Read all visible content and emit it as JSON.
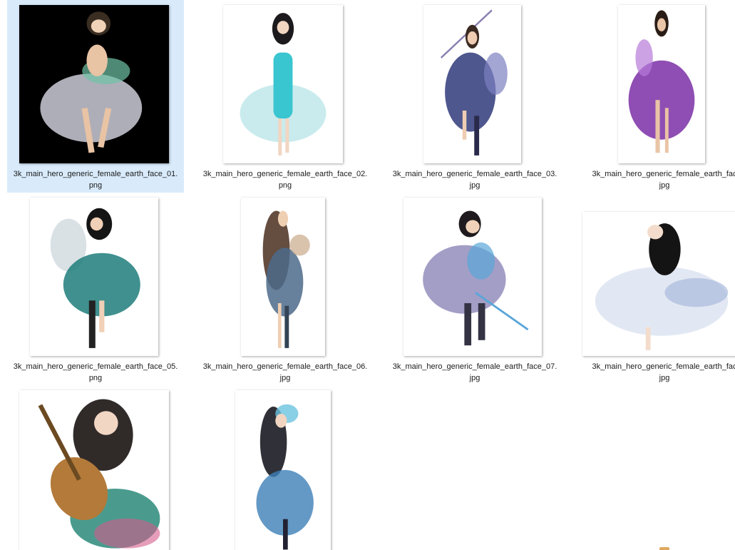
{
  "files": [
    {
      "name": "3k_main_hero_generic_female_earth_face_01.",
      "ext": "png",
      "selected": true,
      "bg": "#000000",
      "robe": "#d9d9e6",
      "accent": "#6fc3a6",
      "hair": "#3a2d22"
    },
    {
      "name": "3k_main_hero_generic_female_earth_face_02.",
      "ext": "png",
      "selected": false,
      "bg": "#ffffff",
      "robe": "#bfe7ea",
      "accent": "#39c6d0",
      "hair": "#1c1a1c"
    },
    {
      "name": "3k_main_hero_generic_female_earth_face_03.",
      "ext": "jpg",
      "selected": false,
      "bg": "#ffffff",
      "robe": "#2f3a7a",
      "accent": "#7c7fc0",
      "hair": "#3a2a22"
    },
    {
      "name": "3k_main_hero_generic_female_earth_fac",
      "ext": "jpg",
      "selected": false,
      "bg": "#ffffff",
      "robe": "#7b2fa6",
      "accent": "#b67ad9",
      "hair": "#2a1c16"
    },
    {
      "name": "3k_main_hero_generic_female_earth_face_05.",
      "ext": "png",
      "selected": false,
      "bg": "#ffffff",
      "robe": "#1d7d7a",
      "accent": "#cfd9df",
      "hair": "#151515"
    },
    {
      "name": "3k_main_hero_generic_female_earth_face_06.",
      "ext": "jpg",
      "selected": false,
      "bg": "#ffffff",
      "robe": "#4c6a8a",
      "accent": "#c9a98a",
      "hair": "#4a2e1e"
    },
    {
      "name": "3k_main_hero_generic_female_earth_face_07.",
      "ext": "jpg",
      "selected": false,
      "bg": "#ffffff",
      "robe": "#8c86b8",
      "accent": "#59a6d9",
      "hair": "#1e1a1e"
    },
    {
      "name": "3k_main_hero_generic_female_earth_fac",
      "ext": "jpg",
      "selected": false,
      "bg": "#ffffff",
      "robe": "#dfe6f2",
      "accent": "#a9bbdd",
      "hair": "#141414"
    },
    {
      "name": "",
      "ext": "",
      "selected": false,
      "bg": "#ffffff",
      "robe": "#2a8a7a",
      "accent": "#b37a3a",
      "hair": "#1a1412"
    },
    {
      "name": "",
      "ext": "",
      "selected": false,
      "bg": "#ffffff",
      "robe": "#3d7fb8",
      "accent": "#6cc3de",
      "hair": "#1a1a22"
    }
  ]
}
